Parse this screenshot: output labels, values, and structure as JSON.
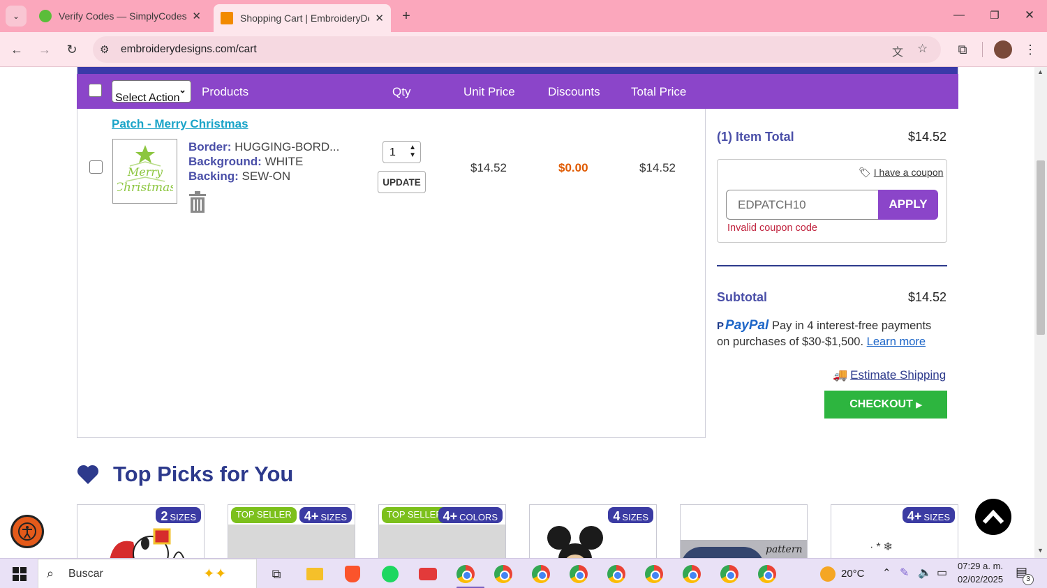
{
  "browser": {
    "tabs": [
      {
        "title": "Verify Codes — SimplyCodes"
      },
      {
        "title": "Shopping Cart | EmbroideryDes"
      }
    ],
    "url": "embroiderydesigns.com/cart"
  },
  "cart": {
    "header": {
      "select_action": "Select Action",
      "products": "Products",
      "qty": "Qty",
      "unit_price": "Unit Price",
      "discounts": "Discounts",
      "total_price": "Total Price"
    },
    "item": {
      "name": "Patch - Merry Christmas",
      "border_label": "Border:",
      "border_value": "HUGGING-BORD...",
      "background_label": "Background:",
      "background_value": "WHITE",
      "backing_label": "Backing:",
      "backing_value": "SEW-ON",
      "qty": "1",
      "update_label": "UPDATE",
      "unit_price": "$14.52",
      "discount": "$0.00",
      "total_price": "$14.52"
    }
  },
  "summary": {
    "item_total_label": "(1) Item Total",
    "item_total_value": "$14.52",
    "coupon_link": "I have a coupon",
    "coupon_value": "EDPATCH10",
    "apply_label": "APPLY",
    "coupon_error": "Invalid coupon code",
    "subtotal_label": "Subtotal",
    "subtotal_value": "$14.52",
    "paypal_brand": "PayPal",
    "paypal_text": "Pay in 4 interest-free payments on purchases of $30-$1,500.",
    "paypal_link": "Learn more",
    "estimate_shipping": "Estimate Shipping",
    "checkout_label": "CHECKOUT"
  },
  "top_picks": {
    "title": "Top Picks for You",
    "cards": [
      {
        "badges": [
          {
            "num": "2",
            "text": "SIZES",
            "color": "blue"
          }
        ]
      },
      {
        "badges": [
          {
            "num": "",
            "text": "TOP SELLER",
            "color": "green"
          },
          {
            "num": "4+",
            "text": "SIZES",
            "color": "blue"
          }
        ]
      },
      {
        "badges": [
          {
            "num": "",
            "text": "TOP SELLER",
            "color": "green"
          },
          {
            "num": "4+",
            "text": "COLORS",
            "color": "blue"
          }
        ]
      },
      {
        "badges": [
          {
            "num": "4",
            "text": "SIZES",
            "color": "blue"
          }
        ]
      },
      {
        "badges": [],
        "caption": "pattern"
      },
      {
        "badges": [
          {
            "num": "4+",
            "text": "SIZES",
            "color": "blue"
          }
        ]
      }
    ]
  },
  "taskbar": {
    "search_placeholder": "Buscar",
    "weather": "20°C",
    "time": "07:29 a. m.",
    "date": "02/02/2025",
    "notifications": "3"
  },
  "colors": {
    "purple": "#8b45c9",
    "navy": "#2d3a8c",
    "link_teal": "#1aa4c8",
    "discount_orange": "#e05a00",
    "checkout_green": "#2db53f"
  }
}
